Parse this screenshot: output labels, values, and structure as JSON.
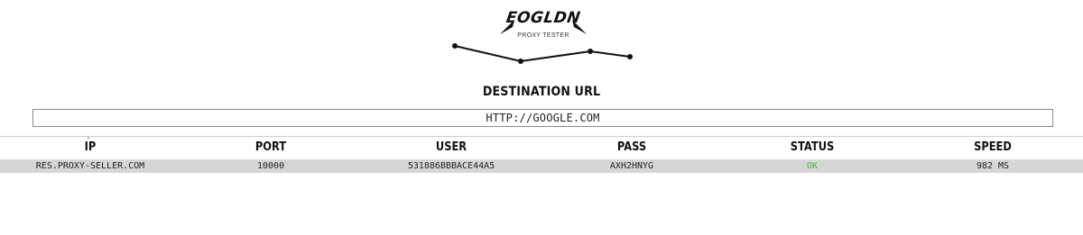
{
  "header": {
    "logo_text": "EOGLDN",
    "subtitle": "PROXY TESTER"
  },
  "destination": {
    "label": "DESTINATION URL",
    "url": "HTTP://GOOGLE.COM"
  },
  "table": {
    "columns": [
      "IP",
      "PORT",
      "USER",
      "PASS",
      "STATUS",
      "SPEED"
    ],
    "rows": [
      {
        "ip": "RES.PROXY-SELLER.COM",
        "port": "10000",
        "user": "531886BBBACE44A5",
        "pass": "AXH2HNYG",
        "status": "OK",
        "speed": "982 MS"
      }
    ]
  },
  "colors": {
    "status_ok": "#2fbf2f",
    "row_background": "#d6d6d6",
    "input_border": "#8a8a8a"
  }
}
